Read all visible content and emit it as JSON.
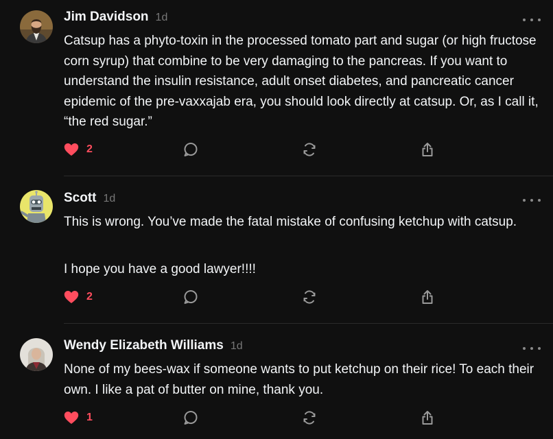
{
  "colors": {
    "background": "#101010",
    "text": "#f3f5f7",
    "muted": "#777777",
    "like": "#ff4d5e",
    "icon": "#9a9a9a"
  },
  "comments": [
    {
      "author": "Jim Davidson",
      "time": "1d",
      "paragraphs": [
        "Catsup has a phyto-toxin in the processed tomato part and sugar (or high fructose corn syrup) that combine to be very damaging to the pancreas. If you want to understand the insulin resistance, adult onset diabetes, and pancreatic cancer epidemic of the pre-vaxxajab era, you should look directly at catsup. Or, as I call it, “the red sugar.”"
      ],
      "likes": "2",
      "liked": true,
      "icons": [
        "heart-icon",
        "comment-icon",
        "repost-icon",
        "share-icon",
        "more-icon"
      ]
    },
    {
      "author": "Scott",
      "time": "1d",
      "paragraphs": [
        "This is wrong. You’ve made the fatal mistake of confusing ketchup with catsup.",
        "I hope you have a good lawyer!!!!"
      ],
      "likes": "2",
      "liked": true,
      "icons": [
        "heart-icon",
        "comment-icon",
        "repost-icon",
        "share-icon",
        "more-icon"
      ]
    },
    {
      "author": "Wendy Elizabeth Williams",
      "time": "1d",
      "paragraphs": [
        "None of my bees-wax if someone wants to put ketchup on their rice! To each their own. I like a pat of butter on mine, thank you."
      ],
      "likes": "1",
      "liked": true,
      "icons": [
        "heart-icon",
        "comment-icon",
        "repost-icon",
        "share-icon",
        "more-icon"
      ]
    }
  ]
}
